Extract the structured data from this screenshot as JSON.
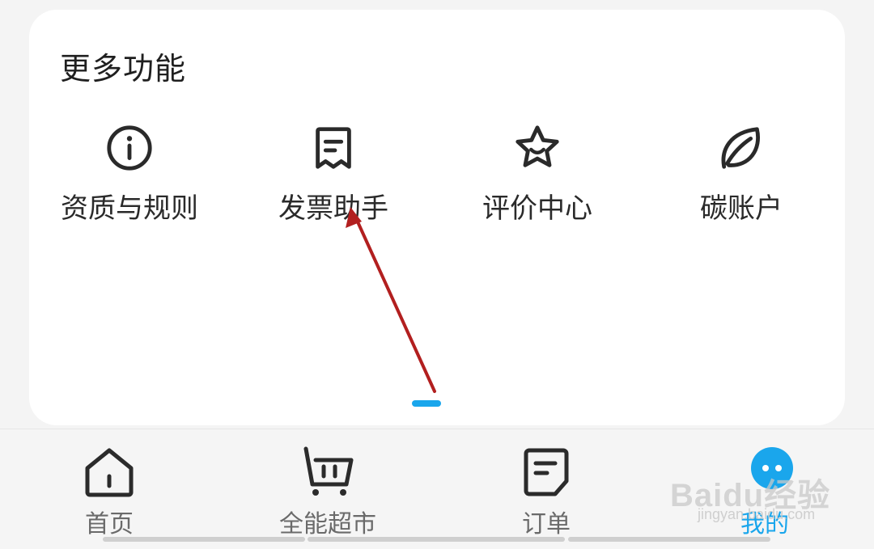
{
  "card": {
    "title": "更多功能",
    "items": [
      {
        "label": "资质与规则",
        "icon": "info-icon"
      },
      {
        "label": "发票助手",
        "icon": "receipt-icon"
      },
      {
        "label": "评价中心",
        "icon": "star-smile-icon"
      },
      {
        "label": "碳账户",
        "icon": "leaf-icon"
      }
    ]
  },
  "bottom_nav": {
    "items": [
      {
        "label": "首页",
        "icon": "home-icon",
        "active": false
      },
      {
        "label": "全能超市",
        "icon": "shopping-bag-icon",
        "active": false
      },
      {
        "label": "订单",
        "icon": "order-icon",
        "active": false
      },
      {
        "label": "我的",
        "icon": "profile-icon",
        "active": true
      }
    ]
  },
  "watermark": {
    "main": "Baidu经验",
    "sub": "jingyan.baidu.com"
  },
  "colors": {
    "accent": "#1aa6ec",
    "annotation_arrow": "#b21f1f",
    "card_bg": "#ffffff",
    "page_bg": "#f4f4f4"
  }
}
